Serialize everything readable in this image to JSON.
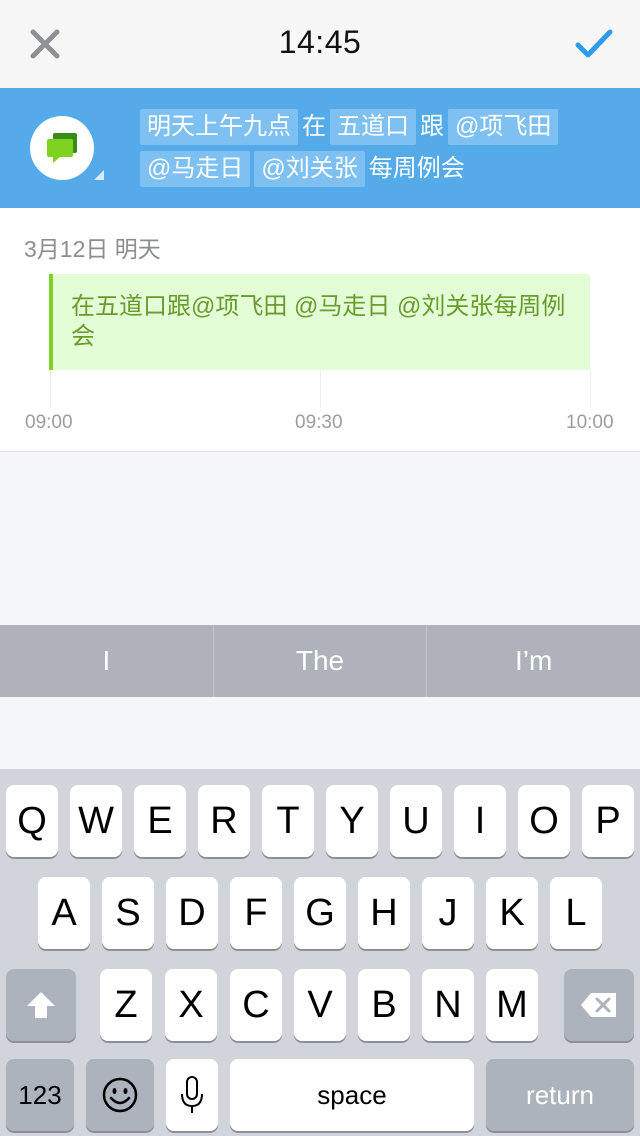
{
  "status": {
    "time": "14:45"
  },
  "nav": {
    "close_icon": "close-x-icon",
    "done_icon": "checkmark-icon"
  },
  "composer": {
    "avatar_icon": "chat-bubbles-icon",
    "line1": [
      {
        "text": "明天上午九点",
        "chip": true
      },
      {
        "text": "在",
        "chip": false
      },
      {
        "text": "五道口",
        "chip": true
      },
      {
        "text": "跟",
        "chip": false
      },
      {
        "text": "@项飞田",
        "chip": true
      }
    ],
    "line2": [
      {
        "text": "@马走日",
        "chip": true
      },
      {
        "text": "@刘关张",
        "chip": true
      },
      {
        "text": "每周例会",
        "chip": false
      }
    ]
  },
  "preview": {
    "date": "3月12日 明天",
    "event_text": "在五道口跟@项飞田 @马走日 @刘关张每周例会",
    "times": [
      "09:00",
      "09:30",
      "10:00"
    ]
  },
  "suggestions": [
    "I",
    "The",
    "I’m"
  ],
  "keyboard": {
    "row1": [
      "Q",
      "W",
      "E",
      "R",
      "T",
      "Y",
      "U",
      "I",
      "O",
      "P"
    ],
    "row2": [
      "A",
      "S",
      "D",
      "F",
      "G",
      "H",
      "J",
      "K",
      "L"
    ],
    "row3": [
      "Z",
      "X",
      "C",
      "V",
      "B",
      "N",
      "M"
    ],
    "shift_icon": "shift-icon",
    "delete_icon": "backspace-icon",
    "numbers_label": "123",
    "emoji_icon": "emoji-icon",
    "mic_icon": "microphone-icon",
    "space_label": "space",
    "return_label": "return"
  },
  "colors": {
    "accent": "#55aaea",
    "chip": "#7fc0f3",
    "event_bg": "#e3fdd6",
    "event_bar": "#7ed321",
    "event_text": "#6a9b2c",
    "check": "#2f9bf0"
  }
}
